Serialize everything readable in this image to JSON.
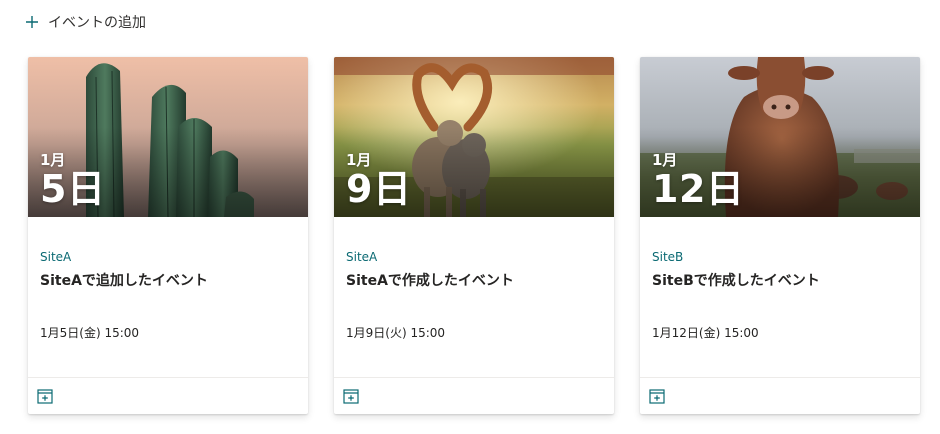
{
  "toolbar": {
    "add_event_label": "イベントの追加",
    "add_icon": "plus-icon"
  },
  "colors": {
    "accent": "#0b6a73",
    "text": "#252423",
    "divider": "#edebe9"
  },
  "events": [
    {
      "month": "1月",
      "day": "5日",
      "site": "SiteA",
      "title": "SiteAで追加したイベント",
      "datetime": "1月5日(金) 15:00",
      "image": "cactus-photo",
      "footer_icon": "add-to-calendar-icon"
    },
    {
      "month": "1月",
      "day": "9日",
      "site": "SiteA",
      "title": "SiteAで作成したイベント",
      "datetime": "1月9日(火) 15:00",
      "image": "cats-photo",
      "footer_icon": "add-to-calendar-icon"
    },
    {
      "month": "1月",
      "day": "12日",
      "site": "SiteB",
      "title": "SiteBで作成したイベント",
      "datetime": "1月12日(金) 15:00",
      "image": "cow-photo",
      "footer_icon": "add-to-calendar-icon"
    }
  ]
}
